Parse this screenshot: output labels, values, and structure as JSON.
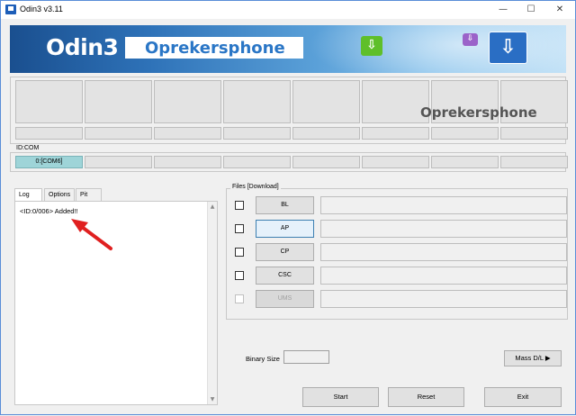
{
  "window": {
    "title": "Odin3 v3.11",
    "minimize": "—",
    "maximize": "☐",
    "close": "✕"
  },
  "banner": {
    "brand": "Odin3",
    "subtitle": "Oprekersphone"
  },
  "watermark": "Oprekersphone",
  "id_com": {
    "label": "ID:COM",
    "ports": [
      "0:[COM6]",
      "",
      "",
      "",
      "",
      "",
      "",
      ""
    ]
  },
  "tabs": [
    "Log",
    "Options",
    "Pit"
  ],
  "log": {
    "lines": [
      "<ID:0/006> Added!!"
    ]
  },
  "files": {
    "legend": "Files [Download]",
    "rows": [
      {
        "label": "BL",
        "enabled": true
      },
      {
        "label": "AP",
        "enabled": true
      },
      {
        "label": "CP",
        "enabled": true
      },
      {
        "label": "CSC",
        "enabled": true
      },
      {
        "label": "UMS",
        "enabled": false
      }
    ]
  },
  "binary_size": {
    "label": "Binary Size",
    "value": ""
  },
  "buttons": {
    "mass_dl": "Mass D/L ▶",
    "start": "Start",
    "reset": "Reset",
    "exit": "Exit"
  },
  "icons": [
    "odin-app-icon",
    "download-green-icon",
    "download-purple-icon",
    "download-blue-icon",
    "red-arrow-annotation"
  ],
  "colors": {
    "active_port": "#9ed4d8",
    "annotation": "#e02020",
    "brand_blue": "#2a76c6"
  }
}
